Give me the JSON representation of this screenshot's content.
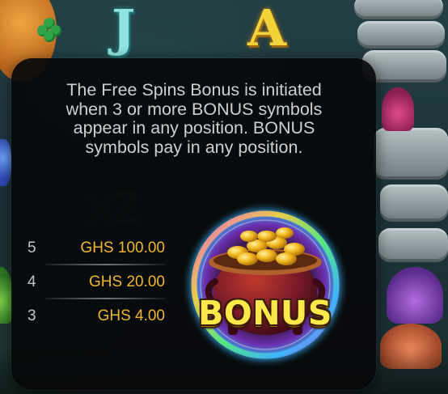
{
  "background": {
    "reel_letters": [
      "J",
      "A"
    ],
    "multiplier_text": "x2"
  },
  "info_panel": {
    "description": "The Free Spins Bonus is initiated when 3 or more BONUS symbols appear in any position. BONUS symbols pay in any position.",
    "paytable": [
      {
        "count": "5",
        "payout": "GHS 100.00"
      },
      {
        "count": "4",
        "payout": "GHS 20.00"
      },
      {
        "count": "3",
        "payout": "GHS 4.00"
      }
    ],
    "symbol": {
      "label": "BONUS",
      "icon": "pot-of-gold-icon"
    }
  },
  "colors": {
    "payout_gold": "#f0b62e",
    "panel_background": "#06080a",
    "bonus_text": "#ffe94a"
  }
}
